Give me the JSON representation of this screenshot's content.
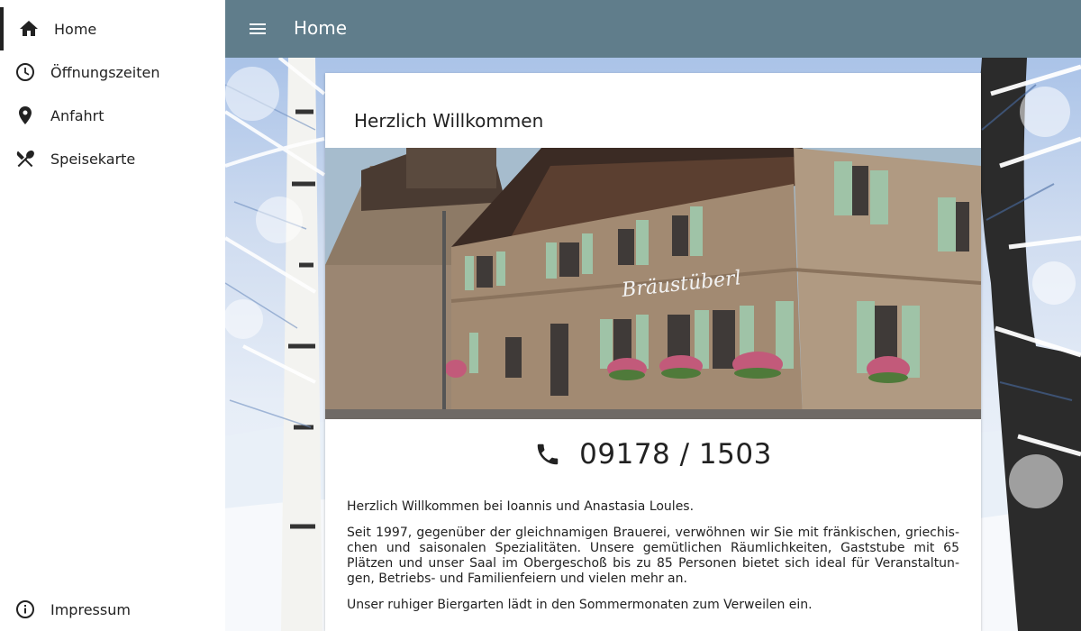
{
  "app": {
    "page_title": "Home"
  },
  "sidebar": {
    "items": [
      {
        "label": "Home",
        "icon": "home-icon",
        "active": true
      },
      {
        "label": "Öffnungszeiten",
        "icon": "clock-icon",
        "active": false
      },
      {
        "label": "Anfahrt",
        "icon": "map-pin-icon",
        "active": false
      },
      {
        "label": "Speisekarte",
        "icon": "cutlery-icon",
        "active": false
      }
    ],
    "footer_item": {
      "label": "Impressum",
      "icon": "info-icon"
    }
  },
  "card": {
    "title": "Herzlich Willkommen",
    "phone": "09178 / 1503",
    "paragraphs": [
      "Herzlich Willkommen bei Ioannis und Anastasia Loules.",
      "Seit 1997, gegenüber der gleichnamigen Brauerei, verwöhnen wir Sie mit fränkischen, griechis­chen und saisonalen Spezialitäten. Unsere gemütlichen Räumlichkeiten, Gaststube mit 65 Plätzen und unser Saal im Obergeschoß bis zu 85 Personen bietet sich ideal für Veranstaltun­gen, Betriebs- und Familienfeiern und vielen mehr an.",
      "Unser ruhiger Biergarten lädt in den Sommermonaten zum Verweilen ein."
    ]
  },
  "colors": {
    "topbar": "#607d8b",
    "sidebar_bg": "#ffffff",
    "text": "#222222"
  }
}
